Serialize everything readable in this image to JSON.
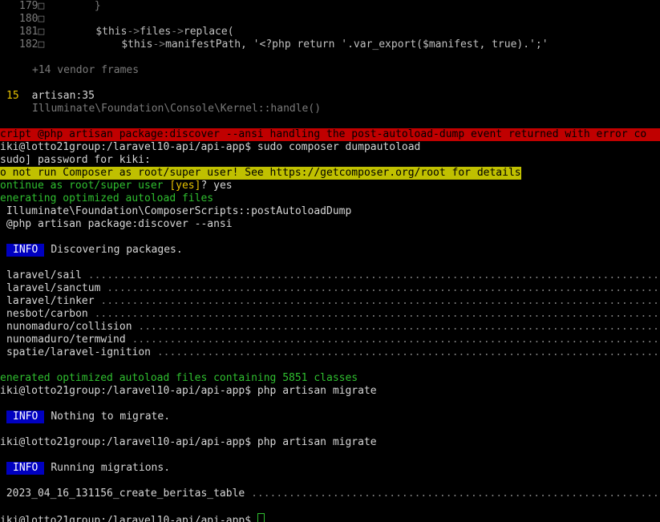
{
  "code": {
    "l179_num": "179□",
    "l179_code": "        }",
    "l180_num": "180□",
    "l181_num": "181□",
    "l181_var": "$this",
    "l181_op": "->",
    "l181_files": "files",
    "l181_op2": "->",
    "l181_func": "replace(",
    "l182_num": "182□",
    "l182_var": "$this",
    "l182_op": "->",
    "l182_rest": "manifestPath, '<?php return '.var_export($manifest, true).';'",
    "vendor_frames": "+14 vendor frames",
    "frame_num": "15",
    "frame_file": "artisan:35",
    "frame_call": "Illuminate\\Foundation\\Console\\Kernel::handle()"
  },
  "output": {
    "error_line": "cript @php artisan package:discover --ansi handling the post-autoload-dump event returned with error co",
    "prompt1": "iki@lotto21group:/laravel10-api/api-app$ sudo composer dumpautoload",
    "sudo": "sudo] password for kiki:",
    "warning": "o not run Composer as root/super user! See https://getcomposer.org/root for details",
    "continue_green": "ontinue as root/super user ",
    "continue_opt": "[yes]",
    "continue_ans": "? yes",
    "generating": "enerating optimized autoload files",
    "postdump": " Illuminate\\Foundation\\ComposerScripts::postAutoloadDump",
    "discover_cmd": " @php artisan package:discover --ansi",
    "info_label": "INFO",
    "info1_text": "Discovering packages.",
    "packages": [
      "laravel/sail",
      "laravel/sanctum",
      "laravel/tinker",
      "nesbot/carbon",
      "nunomaduro/collision",
      "nunomaduro/termwind",
      "spatie/laravel-ignition"
    ],
    "generated": "enerated optimized autoload files containing 5851 classes",
    "prompt2": "iki@lotto21group:/laravel10-api/api-app$ php artisan migrate",
    "info2_text": "Nothing to migrate.",
    "prompt3": "iki@lotto21group:/laravel10-api/api-app$ php artisan migrate",
    "info3_text": "Running migrations.",
    "migration": " 2023_04_16_131156_create_beritas_table",
    "prompt4": "iki@lotto21group:/laravel10-api/api-app$ "
  },
  "colors": {
    "background": "#000000",
    "error_bar": "#c00000",
    "warning_bar": "#c0c000",
    "info_badge": "#0000c0",
    "green": "#2fbf2f"
  }
}
